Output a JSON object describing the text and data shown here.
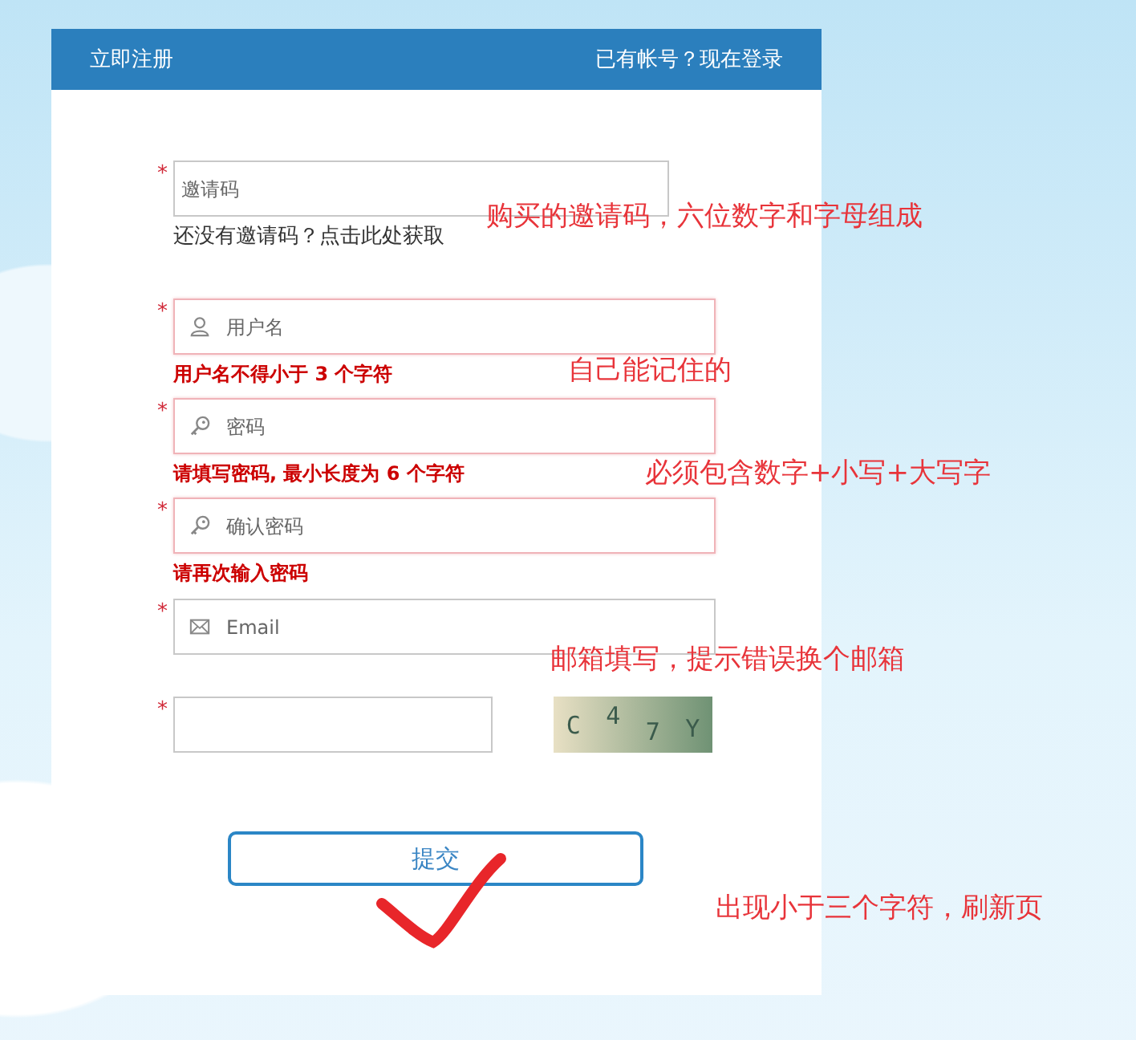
{
  "header": {
    "title": "立即注册",
    "login_link": "已有帐号？现在登录"
  },
  "fields": [
    {
      "kind": "invite",
      "required": true,
      "required_mark": "*",
      "invalid": false,
      "placeholder": "邀请码",
      "hint": "还没有邀请码？点击此处获取"
    },
    {
      "kind": "user",
      "required": true,
      "required_mark": "*",
      "invalid": true,
      "placeholder": "用户名",
      "error": "用户名不得小于 **3** 个字符"
    },
    {
      "kind": "password",
      "required": true,
      "required_mark": "*",
      "invalid": true,
      "placeholder": "密码",
      "error": "请填写密码, 最小长度为 **6** 个字符"
    },
    {
      "kind": "password",
      "required": true,
      "required_mark": "*",
      "invalid": true,
      "placeholder": "确认密码",
      "error": "请再次输入密码"
    },
    {
      "kind": "email",
      "required": true,
      "required_mark": "*",
      "invalid": false,
      "placeholder": "Email"
    },
    {
      "kind": "captcha",
      "required": true,
      "required_mark": "*",
      "invalid": false,
      "captcha": [
        "C",
        "4",
        "7",
        "Y"
      ]
    }
  ],
  "submit": "提交",
  "annotations": [
    "购买的邀请码，六位数字和字母组成",
    "自己能记住的",
    "必须包含数字+小写+大写字",
    "邮箱填写，提示错误换个邮箱",
    "出现小于三个字符，刷新页"
  ]
}
